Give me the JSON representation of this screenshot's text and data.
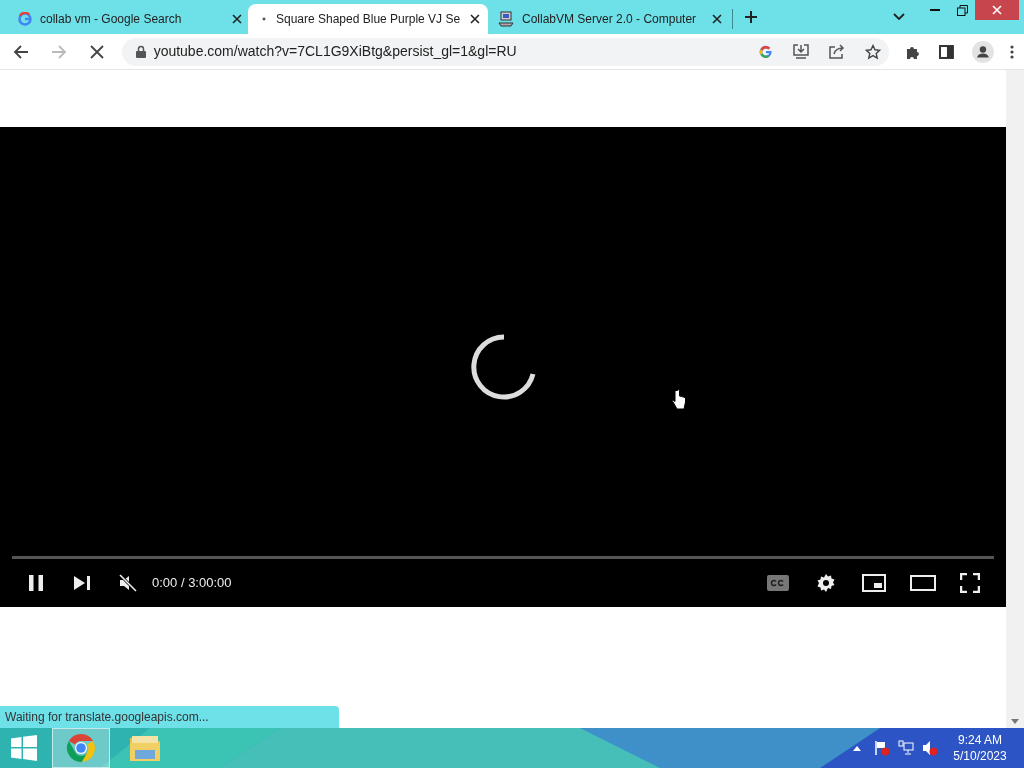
{
  "tabs": [
    {
      "title": "collab vm - Google Search",
      "kind": "google",
      "selected": false
    },
    {
      "title": "Square Shaped Blue Purple VJ Se",
      "kind": "loading",
      "selected": true
    },
    {
      "title": "CollabVM Server 2.0 - Computer",
      "kind": "computer",
      "selected": false
    }
  ],
  "toolbar": {
    "loading": true,
    "url": "youtube.com/watch?v=7CL1G9XiBtg&persist_gl=1&gl=RU"
  },
  "player": {
    "playing": true,
    "muted": true,
    "time": "0:00 / 3:00:00"
  },
  "status_bar": "Waiting for translate.googleapis.com...",
  "taskbar": {
    "apps": [
      {
        "kind": "chrome",
        "selected": true
      },
      {
        "kind": "explorer",
        "selected": false
      }
    ],
    "time": "9:24 AM",
    "date": "5/10/2023"
  }
}
